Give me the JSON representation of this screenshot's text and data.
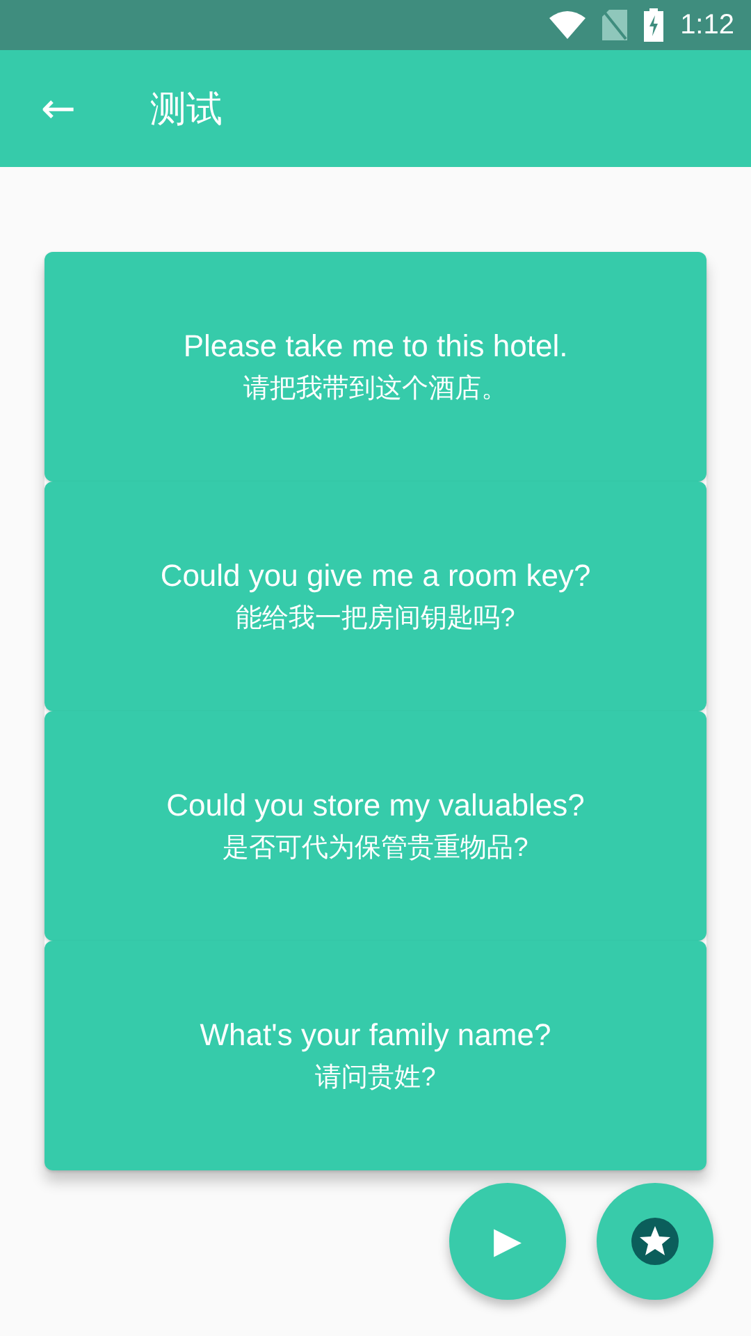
{
  "status_bar": {
    "time": "1:12"
  },
  "app_bar": {
    "back": "←",
    "title": "测试"
  },
  "cards": [
    {
      "english": "Please take me to this hotel.",
      "chinese": "请把我带到这个酒店。"
    },
    {
      "english": "Could you give me a room key?",
      "chinese": "能给我一把房间钥匙吗?"
    },
    {
      "english": "Could you store my valuables?",
      "chinese": "是否可代为保管贵重物品?"
    },
    {
      "english": "What's your family name?",
      "chinese": "请问贵姓?"
    }
  ],
  "fab_play": {
    "symbol": "▶"
  }
}
